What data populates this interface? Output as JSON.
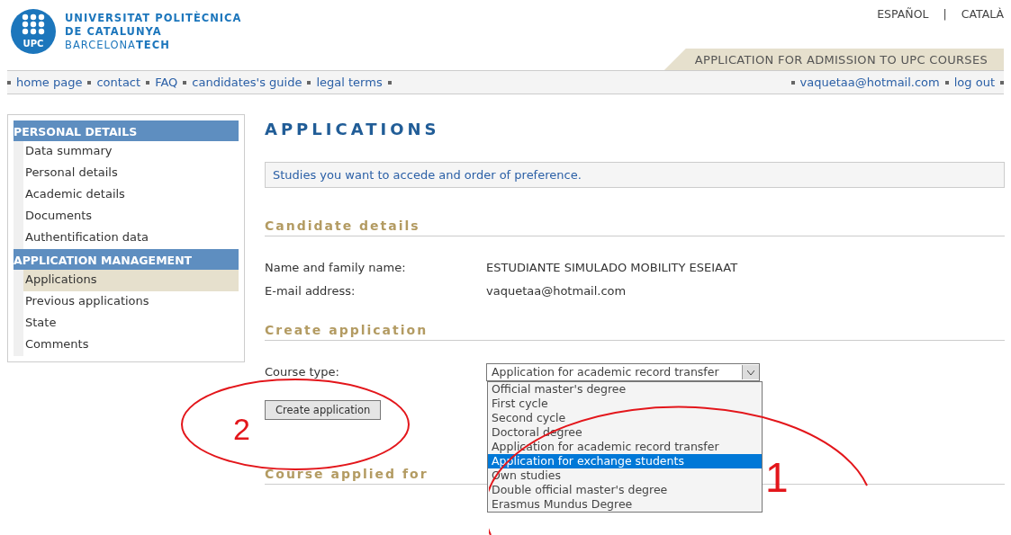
{
  "logo": {
    "mark": "UPC",
    "lines": [
      "UNIVERSITAT POLITÈCNICA",
      "DE CATALUNYA"
    ],
    "sub_a": "BARCELONA",
    "sub_b": "TECH"
  },
  "languages": [
    "ESPAÑOL",
    "|",
    "CATALÀ"
  ],
  "banner": "APPLICATION FOR ADMISSION TO UPC COURSES",
  "nav_left": [
    "home page",
    "contact",
    "FAQ",
    "candidates's guide",
    "legal terms"
  ],
  "nav_right": [
    "vaquetaa@hotmail.com",
    "log out"
  ],
  "sidebar": [
    {
      "title": "PERSONAL DETAILS",
      "items": [
        {
          "label": "Data summary",
          "selected": false
        },
        {
          "label": "Personal details",
          "selected": false
        },
        {
          "label": "Academic details",
          "selected": false
        },
        {
          "label": "Documents",
          "selected": false
        },
        {
          "label": "Authentification data",
          "selected": false
        }
      ]
    },
    {
      "title": "APPLICATION MANAGEMENT",
      "items": [
        {
          "label": "Applications",
          "selected": true
        },
        {
          "label": "Previous applications",
          "selected": false
        },
        {
          "label": "State",
          "selected": false
        },
        {
          "label": "Comments",
          "selected": false
        }
      ]
    }
  ],
  "page_title": "APPLICATIONS",
  "info": "Studies you want to accede and order of preference.",
  "candidate": {
    "title": "Candidate details",
    "fields": [
      {
        "label": "Name and family name:",
        "value": "ESTUDIANTE SIMULADO MOBILITY ESEIAAT"
      },
      {
        "label": "E-mail address:",
        "value": "vaquetaa@hotmail.com"
      }
    ]
  },
  "create": {
    "title": "Create application",
    "course_type_label": "Course type:",
    "course_type_value": "Application for academic record transfer",
    "button": "Create application",
    "options": [
      {
        "label": "Official master's degree",
        "selected": false
      },
      {
        "label": "First cycle",
        "selected": false
      },
      {
        "label": "Second cycle",
        "selected": false
      },
      {
        "label": "Doctoral degree",
        "selected": false
      },
      {
        "label": "Application for academic record transfer",
        "selected": false
      },
      {
        "label": "Application for exchange students",
        "selected": true
      },
      {
        "label": "Own studies",
        "selected": false
      },
      {
        "label": "Double official master's degree",
        "selected": false
      },
      {
        "label": "Erasmus Mundus Degree",
        "selected": false
      }
    ]
  },
  "course_applied": {
    "title": "Course applied for"
  },
  "annotations": [
    "1",
    "2"
  ]
}
